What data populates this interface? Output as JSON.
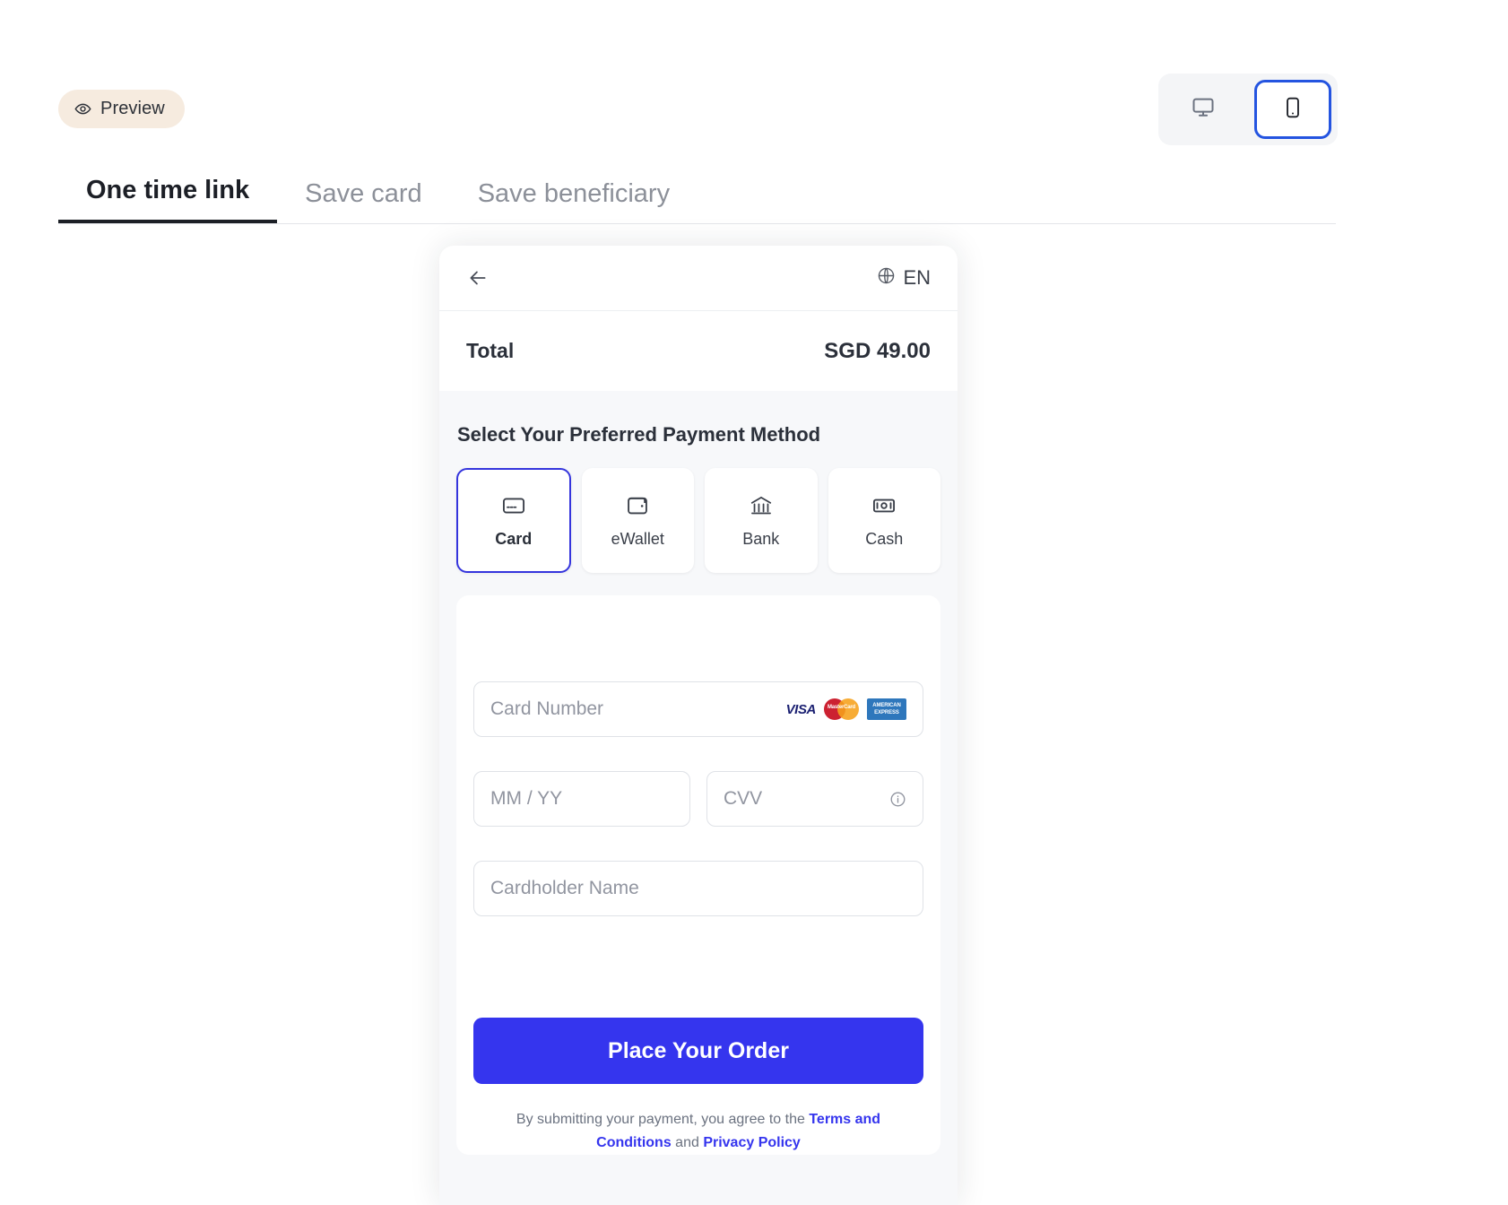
{
  "topbar": {
    "preview_label": "Preview",
    "preview_icon": "eye-icon",
    "devices": [
      {
        "name": "desktop",
        "icon": "monitor-icon",
        "active": false
      },
      {
        "name": "mobile",
        "icon": "mobile-device-icon",
        "active": true
      }
    ]
  },
  "tabs": [
    {
      "label": "One time link",
      "active": true
    },
    {
      "label": "Save card",
      "active": false
    },
    {
      "label": "Save beneficiary",
      "active": false
    }
  ],
  "preview": {
    "header": {
      "back_icon": "arrow-left-icon",
      "language_icon": "globe-icon",
      "language": "EN"
    },
    "total": {
      "label": "Total",
      "amount": "SGD 49.00"
    },
    "section_title": "Select Your Preferred Payment Method",
    "methods": [
      {
        "label": "Card",
        "icon": "credit-card-icon",
        "selected": true
      },
      {
        "label": "eWallet",
        "icon": "wallet-icon",
        "selected": false
      },
      {
        "label": "Bank",
        "icon": "bank-icon",
        "selected": false
      },
      {
        "label": "Cash",
        "icon": "banknote-icon",
        "selected": false
      }
    ],
    "form": {
      "card_number_placeholder": "Card Number",
      "expiry_placeholder": "MM / YY",
      "cvv_placeholder": "CVV",
      "cvv_info_icon": "info-circle-icon",
      "cardholder_placeholder": "Cardholder Name",
      "brands": [
        {
          "name": "visa",
          "text": "VISA"
        },
        {
          "name": "mastercard",
          "text": "MasterCard"
        },
        {
          "name": "amex",
          "line1": "AMERICAN",
          "line2": "EXPRESS"
        }
      ]
    },
    "submit_label": "Place Your Order",
    "terms": {
      "prefix": "By submitting your payment, you agree to the ",
      "terms_link": "Terms and Conditions",
      "middle": " and ",
      "privacy_link": "Privacy Policy"
    }
  },
  "colors": {
    "accent": "#3535ee",
    "device_active_border": "#2454e0",
    "badge_bg": "#f6ebdf"
  }
}
